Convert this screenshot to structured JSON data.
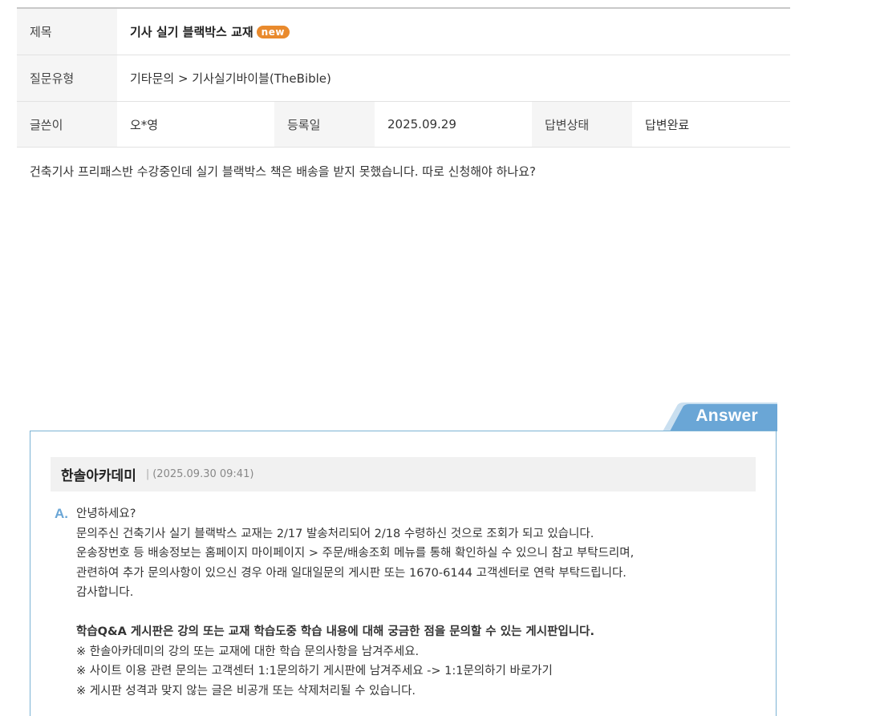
{
  "info": {
    "title_label": "제목",
    "title_value": "기사 실기 블랙박스 교재",
    "new_badge": "new",
    "type_label": "질문유형",
    "type_value": "기타문의 > 기사실기바이블(TheBible)",
    "author_label": "글쓴이",
    "author_value": "오*영",
    "date_label": "등록일",
    "date_value": "2025.09.29",
    "status_label": "답변상태",
    "status_value": "답변완료"
  },
  "question": {
    "body": "건축기사 프리패스반 수강중인데 실기 블랙박스 책은 배송을 받지 못했습니다. 따로 신청해야 하나요?"
  },
  "answer": {
    "tab_label": "Answer",
    "answerer": "한솔아카데미",
    "separator": "|",
    "datetime": "(2025.09.30 09:41)",
    "mark": "A.",
    "lines": [
      "안녕하세요?",
      "문의주신 건축기사 실기 블랙박스 교재는 2/17 발송처리되어 2/18 수령하신 것으로 조회가 되고 있습니다.",
      "운송장번호 등 배송정보는 홈페이지 마이페이지 > 주문/배송조회 메뉴를 통해 확인하실 수 있으니 참고 부탁드리며,",
      "관련하여 추가 문의사항이 있으신 경우 아래 일대일문의 게시판 또는 1670-6144 고객센터로 연락 부탁드립니다.",
      "감사합니다."
    ],
    "notice_title": "학습Q&A 게시판은 강의 또는 교재 학습도중 학습 내용에 대해 궁금한 점을 문의할 수 있는 게시판입니다.",
    "notice_lines": [
      "※ 한솔아카데미의 강의 또는 교재에 대한 학습 문의사항을 남겨주세요.",
      "※ 사이트 이용 관련 문의는 고객센터 1:1문의하기 게시판에 남겨주세요 -> 1:1문의하기 바로가기",
      "※ 게시판 성격과 맞지 않는 글은 비공개 또는 삭제처리될 수 있습니다."
    ]
  },
  "colors": {
    "answer_accent": "#6aa6d6",
    "answer_border": "#7bb3d4",
    "new_badge": "#e98a2d"
  }
}
